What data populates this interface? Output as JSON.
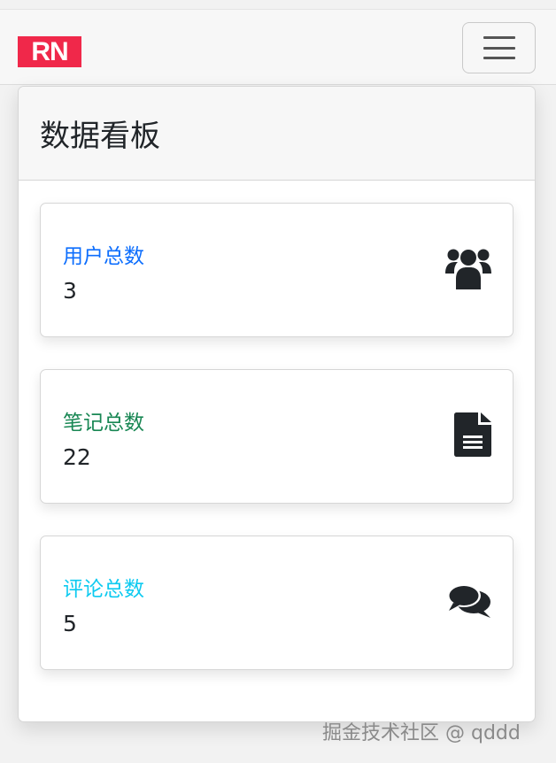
{
  "navbar": {
    "logo_text": "RN",
    "logo_color": "#f0284a",
    "menu_icon": "hamburger-icon"
  },
  "board": {
    "title": "数据看板",
    "cards": [
      {
        "label": "用户总数",
        "value": "3",
        "label_color": "#0d6efd",
        "icon": "users-icon"
      },
      {
        "label": "笔记总数",
        "value": "22",
        "label_color": "#198754",
        "icon": "document-icon"
      },
      {
        "label": "评论总数",
        "value": "5",
        "label_color": "#0dcaf0",
        "icon": "comments-icon"
      }
    ]
  },
  "watermark": "掘金技术社区 @ qddd"
}
